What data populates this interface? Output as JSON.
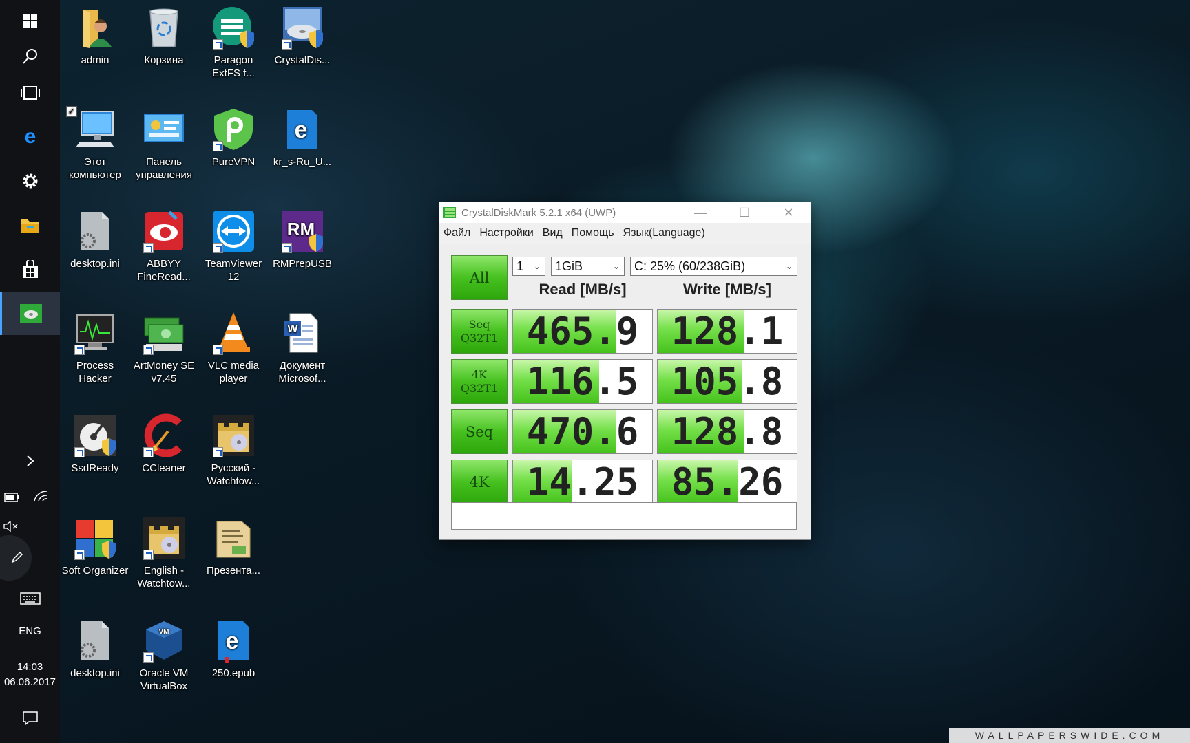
{
  "taskbar": {
    "buttons": [
      {
        "name": "start",
        "icon": "windows-logo-icon"
      },
      {
        "name": "search",
        "icon": "search-icon"
      },
      {
        "name": "task-view",
        "icon": "task-view-icon"
      },
      {
        "name": "edge",
        "icon": "edge-icon"
      },
      {
        "name": "settings",
        "icon": "gear-icon"
      },
      {
        "name": "explorer",
        "icon": "folder-icon"
      },
      {
        "name": "store",
        "icon": "store-icon"
      },
      {
        "name": "crystaldiskmark",
        "icon": "crystaldiskmark-icon"
      }
    ],
    "language": "ENG",
    "time": "14:03",
    "date": "06.06.2017"
  },
  "desktop_icons": [
    {
      "label": "admin",
      "icon": "user-folder-icon"
    },
    {
      "label": "Корзина",
      "icon": "recycle-bin-icon"
    },
    {
      "label": "Paragon ExtFS f...",
      "icon": "paragon-icon"
    },
    {
      "label": "CrystalDis...",
      "icon": "crystaldisk-icon"
    },
    {
      "label": "Этот компьютер",
      "icon": "computer-icon"
    },
    {
      "label": "Панель управления",
      "icon": "control-panel-icon"
    },
    {
      "label": "PureVPN",
      "icon": "purevpn-icon"
    },
    {
      "label": "kr_s-Ru_U...",
      "icon": "edge-document-icon"
    },
    {
      "label": "desktop.ini",
      "icon": "settings-file-icon"
    },
    {
      "label": "ABBYY FineRead...",
      "icon": "abbyy-icon"
    },
    {
      "label": "TeamViewer 12",
      "icon": "teamviewer-icon"
    },
    {
      "label": "RMPrepUSB",
      "icon": "rmprepusb-icon"
    },
    {
      "label": "Process Hacker",
      "icon": "process-hacker-icon"
    },
    {
      "label": "ArtMoney SE v7.45",
      "icon": "artmoney-icon"
    },
    {
      "label": "VLC media player",
      "icon": "vlc-icon"
    },
    {
      "label": "Документ Microsof...",
      "icon": "word-document-icon"
    },
    {
      "label": "SsdReady",
      "icon": "ssdready-icon"
    },
    {
      "label": "CCleaner",
      "icon": "ccleaner-icon"
    },
    {
      "label": "Русский - Watchtow...",
      "icon": "watchtower-icon"
    },
    {
      "label": "Soft Organizer",
      "icon": "soft-organizer-icon"
    },
    {
      "label": "English - Watchtow...",
      "icon": "watchtower-icon"
    },
    {
      "label": "Презента...",
      "icon": "presentation-file-icon"
    },
    {
      "label": "desktop.ini",
      "icon": "settings-file-icon"
    },
    {
      "label": "Oracle VM VirtualBox",
      "icon": "virtualbox-icon"
    },
    {
      "label": "250.epub",
      "icon": "epub-file-icon"
    }
  ],
  "cdm": {
    "title": "CrystalDiskMark 5.2.1 x64 (UWP)",
    "menu": [
      "Файл",
      "Настройки",
      "Вид",
      "Помощь",
      "Язык(Language)"
    ],
    "all_button": "All",
    "count": "1",
    "size": "1GiB",
    "drive": "C: 25% (60/238GiB)",
    "read_header": "Read [MB/s]",
    "write_header": "Write [MB/s]",
    "rows": [
      {
        "test_line1": "Seq",
        "test_line2": "Q32T1",
        "read": "465.9",
        "write": "128.1",
        "read_level": 0.74,
        "write_level": 0.62
      },
      {
        "test_line1": "4K",
        "test_line2": "Q32T1",
        "read": "116.5",
        "write": "105.8",
        "read_level": 0.62,
        "write_level": 0.61
      },
      {
        "test_line1": "Seq",
        "test_line2": "",
        "read": "470.6",
        "write": "128.8",
        "read_level": 0.74,
        "write_level": 0.62
      },
      {
        "test_line1": "4K",
        "test_line2": "",
        "read": "14.25",
        "write": "85.26",
        "read_level": 0.42,
        "write_level": 0.58
      }
    ],
    "status_text": ""
  },
  "watermark": "WALLPAPERSWIDE.COM"
}
